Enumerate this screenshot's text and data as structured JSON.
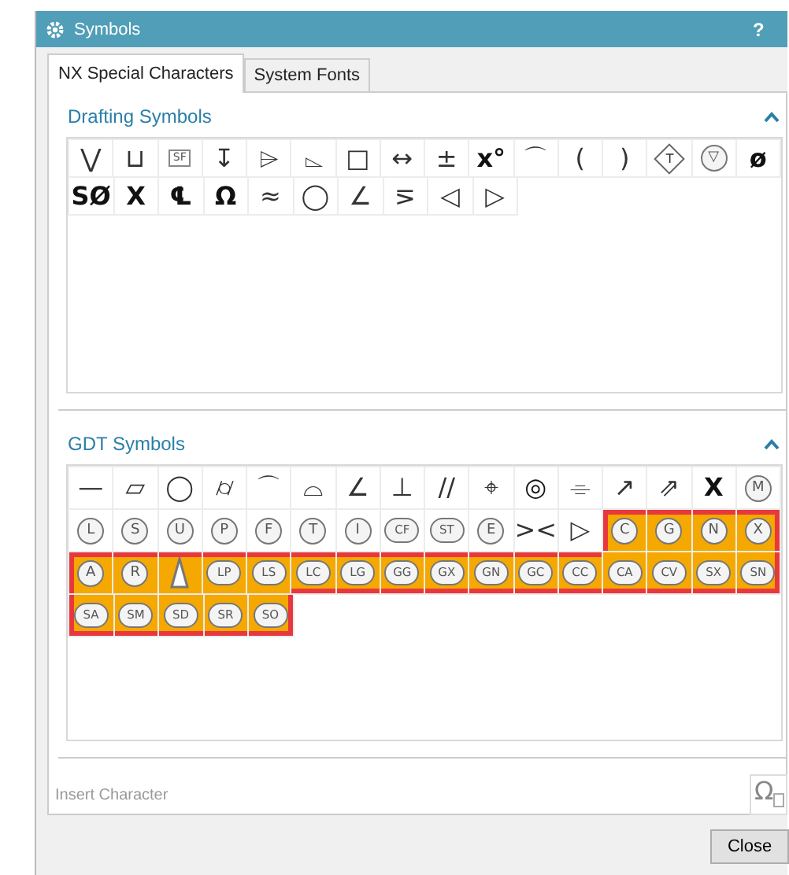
{
  "window": {
    "title": "Symbols",
    "help": "?"
  },
  "tabs": [
    {
      "label": "NX Special Characters",
      "selected": true
    },
    {
      "label": "System Fonts",
      "selected": false
    }
  ],
  "sections": [
    {
      "title": "Drafting Symbols",
      "expanded": true,
      "rows": [
        [
          {
            "kind": "plain",
            "text": "⋁",
            "selected": false
          },
          {
            "kind": "plain",
            "text": "⊔",
            "selected": false
          },
          {
            "kind": "boxed",
            "text": "SF",
            "selected": false
          },
          {
            "kind": "plain",
            "text": "↧",
            "selected": false
          },
          {
            "kind": "plain",
            "text": "⌲",
            "selected": false
          },
          {
            "kind": "plain",
            "text": "⌳",
            "selected": false
          },
          {
            "kind": "plain",
            "text": "□",
            "selected": false
          },
          {
            "kind": "plain",
            "text": "↔",
            "selected": false
          },
          {
            "kind": "plain",
            "text": "±",
            "selected": false
          },
          {
            "kind": "bold",
            "text": "x°",
            "selected": false
          },
          {
            "kind": "plain",
            "text": "⌒",
            "selected": false
          },
          {
            "kind": "plain",
            "text": "(",
            "selected": false
          },
          {
            "kind": "plain",
            "text": ")",
            "selected": false
          },
          {
            "kind": "diamond",
            "text": "T",
            "selected": false
          },
          {
            "kind": "circled",
            "text": "▽",
            "selected": false
          },
          {
            "kind": "bold",
            "text": "ø",
            "selected": false
          }
        ],
        [
          {
            "kind": "bold",
            "text": "SØ",
            "selected": false
          },
          {
            "kind": "bold",
            "text": "X",
            "selected": false
          },
          {
            "kind": "bold",
            "text": "℄",
            "selected": false
          },
          {
            "kind": "bold",
            "text": "Ω",
            "selected": false
          },
          {
            "kind": "plain",
            "text": "≈",
            "selected": false
          },
          {
            "kind": "plain",
            "text": "◯",
            "selected": false
          },
          {
            "kind": "plain",
            "text": "∠",
            "selected": false
          },
          {
            "kind": "plain",
            "text": "⋝",
            "selected": false
          },
          {
            "kind": "plain",
            "text": "◁",
            "selected": false
          },
          {
            "kind": "plain",
            "text": "▷",
            "selected": false
          }
        ]
      ]
    },
    {
      "title": "GDT Symbols",
      "expanded": true,
      "rows": [
        [
          {
            "kind": "plain",
            "text": "—",
            "selected": false
          },
          {
            "kind": "plain",
            "text": "▱",
            "selected": false
          },
          {
            "kind": "plain",
            "text": "◯",
            "selected": false
          },
          {
            "kind": "plain",
            "text": "⌭",
            "selected": false
          },
          {
            "kind": "plain",
            "text": "⌒",
            "selected": false
          },
          {
            "kind": "plain",
            "text": "⌓",
            "selected": false
          },
          {
            "kind": "plain",
            "text": "∠",
            "selected": false
          },
          {
            "kind": "plain",
            "text": "⊥",
            "selected": false
          },
          {
            "kind": "plain",
            "text": "//",
            "selected": false
          },
          {
            "kind": "plain",
            "text": "⌖",
            "selected": false
          },
          {
            "kind": "bold",
            "text": "◎",
            "selected": false
          },
          {
            "kind": "plain",
            "text": "⌯",
            "selected": false
          },
          {
            "kind": "plain",
            "text": "↗",
            "selected": false
          },
          {
            "kind": "plain",
            "text": "⇗",
            "selected": false
          },
          {
            "kind": "bold",
            "text": "X",
            "selected": false
          },
          {
            "kind": "circled",
            "text": "M",
            "selected": false
          }
        ],
        [
          {
            "kind": "circled",
            "text": "L",
            "selected": false
          },
          {
            "kind": "circled",
            "text": "S",
            "selected": false
          },
          {
            "kind": "circled",
            "text": "U",
            "selected": false
          },
          {
            "kind": "circled",
            "text": "P",
            "selected": false
          },
          {
            "kind": "circled",
            "text": "F",
            "selected": false
          },
          {
            "kind": "circled",
            "text": "T",
            "selected": false
          },
          {
            "kind": "circled",
            "text": "I",
            "selected": false
          },
          {
            "kind": "rounded",
            "text": "CF",
            "selected": false
          },
          {
            "kind": "rounded",
            "text": "ST",
            "selected": false
          },
          {
            "kind": "circled",
            "text": "E",
            "selected": false
          },
          {
            "kind": "plain",
            "text": "><",
            "selected": false
          },
          {
            "kind": "plain",
            "text": "▷",
            "selected": false
          },
          {
            "kind": "circled",
            "text": "C",
            "selected": true
          },
          {
            "kind": "circled",
            "text": "G",
            "selected": true
          },
          {
            "kind": "circled",
            "text": "N",
            "selected": true
          },
          {
            "kind": "circled",
            "text": "X",
            "selected": true
          }
        ],
        [
          {
            "kind": "circled",
            "text": "A",
            "selected": true
          },
          {
            "kind": "circled",
            "text": "R",
            "selected": true
          },
          {
            "kind": "triangle",
            "selected": true
          },
          {
            "kind": "rounded",
            "text": "LP",
            "selected": true
          },
          {
            "kind": "rounded",
            "text": "LS",
            "selected": true
          },
          {
            "kind": "rounded",
            "text": "LC",
            "selected": true
          },
          {
            "kind": "rounded",
            "text": "LG",
            "selected": true
          },
          {
            "kind": "rounded",
            "text": "GG",
            "selected": true
          },
          {
            "kind": "rounded",
            "text": "GX",
            "selected": true
          },
          {
            "kind": "rounded",
            "text": "GN",
            "selected": true
          },
          {
            "kind": "rounded",
            "text": "GC",
            "selected": true
          },
          {
            "kind": "rounded",
            "text": "CC",
            "selected": true
          },
          {
            "kind": "rounded",
            "text": "CA",
            "selected": true
          },
          {
            "kind": "rounded",
            "text": "CV",
            "selected": true
          },
          {
            "kind": "rounded",
            "text": "SX",
            "selected": true
          },
          {
            "kind": "rounded",
            "text": "SN",
            "selected": true
          }
        ],
        [
          {
            "kind": "rounded",
            "text": "SA",
            "selected": true
          },
          {
            "kind": "rounded",
            "text": "SM",
            "selected": true
          },
          {
            "kind": "rounded",
            "text": "SD",
            "selected": true
          },
          {
            "kind": "rounded",
            "text": "SR",
            "selected": true
          },
          {
            "kind": "rounded",
            "text": "SO",
            "selected": true
          }
        ]
      ]
    }
  ],
  "insert": {
    "label": "Insert Character",
    "button_glyph": "Ω"
  },
  "buttons": [
    "Close"
  ]
}
